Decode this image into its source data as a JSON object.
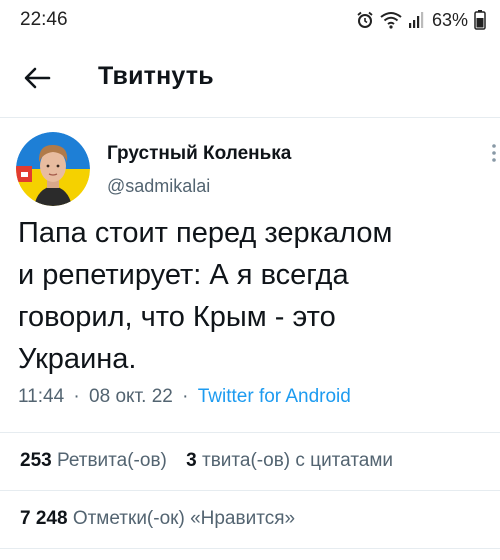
{
  "status_bar": {
    "time": "22:46",
    "battery": "63%",
    "icons": [
      "alarm-icon",
      "wifi-icon",
      "signal-icon"
    ]
  },
  "header": {
    "title": "Твитнуть",
    "back_icon": "arrow-left-icon"
  },
  "tweet": {
    "author_name": "Грустный Коленька",
    "author_handle": "@sadmikalai",
    "text": "Папа стоит перед зеркалом\nи репетирует: А я всегда\nговорил, что Крым - это\nУкраина.",
    "time": "11:44",
    "date": "08 окт. 22",
    "separator": "·",
    "source": "Twitter for Android"
  },
  "stats": {
    "retweets_count": "253",
    "retweets_label": "Ретвита(-ов)",
    "quotes_count": "3",
    "quotes_label": "твита(-ов) с цитатами",
    "likes_count": "7 248",
    "likes_label": "Отметки(-ок) «Нравится»"
  },
  "colors": {
    "text": "#0f1419",
    "secondary": "#536471",
    "link": "#1d9bf0",
    "divider": "#e6ecf0",
    "flag_blue": "#1e7fd6",
    "flag_yellow": "#f5d100"
  }
}
